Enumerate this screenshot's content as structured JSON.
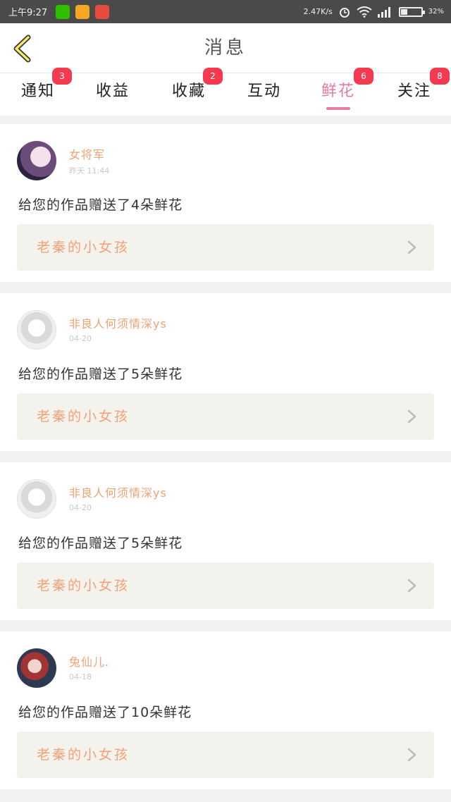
{
  "status_bar": {
    "time": "上午9:27",
    "speed": "2.47K/s",
    "battery_pct": "32%",
    "battery_level": 0.32
  },
  "header": {
    "title": "消息"
  },
  "tabs": [
    {
      "label": "通知",
      "badge": "3"
    },
    {
      "label": "收益",
      "badge": ""
    },
    {
      "label": "收藏",
      "badge": "2"
    },
    {
      "label": "互动",
      "badge": ""
    },
    {
      "label": "鲜花",
      "badge": "6"
    },
    {
      "label": "关注",
      "badge": "8"
    }
  ],
  "active_tab": "鲜花",
  "messages": [
    {
      "user": "女将军",
      "time": "昨天 11:44",
      "text": "给您的作品赠送了4朵鲜花",
      "work": "老秦的小女孩"
    },
    {
      "user": "非良人何须情深ys",
      "time": "04-20",
      "text": "给您的作品赠送了5朵鲜花",
      "work": "老秦的小女孩"
    },
    {
      "user": "非良人何须情深ys",
      "time": "04-20",
      "text": "给您的作品赠送了5朵鲜花",
      "work": "老秦的小女孩"
    },
    {
      "user": "兔仙儿.",
      "time": "04-18",
      "text": "给您的作品赠送了10朵鲜花",
      "work": "老秦的小女孩"
    }
  ],
  "colors": {
    "accent": "#e97aa8",
    "name": "#f0a276",
    "badge": "#f43a4e"
  }
}
